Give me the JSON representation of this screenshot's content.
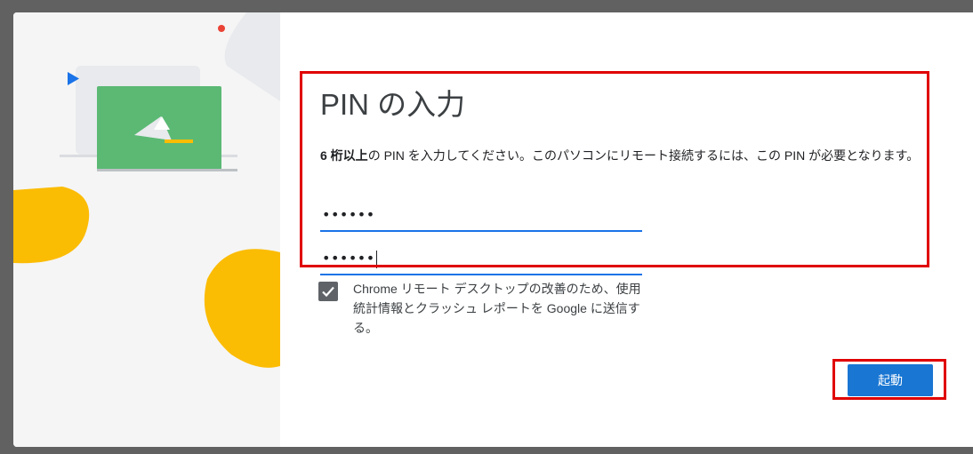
{
  "dialog": {
    "title": "PIN の入力",
    "description_bold": "6 桁以上",
    "description_rest": "の PIN を入力してください。このパソコンにリモート接続するには、この PIN が必要となります。",
    "pin_field_1_value": "••••••",
    "pin_field_2_value": "••••••",
    "checkbox_checked": true,
    "checkbox_label": "Chrome リモート デスクトップの改善のため、使用統計情報とクラッシュ レポートを Google に送信する。",
    "start_button_label": "起動"
  },
  "colors": {
    "accent": "#1976d2",
    "highlight": "#e00000",
    "illustration_green": "#5bb974",
    "illustration_yellow": "#fbbc04",
    "illustration_blue": "#1a73e8",
    "illustration_red": "#ea4335"
  },
  "icons": {
    "checkbox": "check-icon",
    "illustration": "remote-desktop-illustration"
  }
}
